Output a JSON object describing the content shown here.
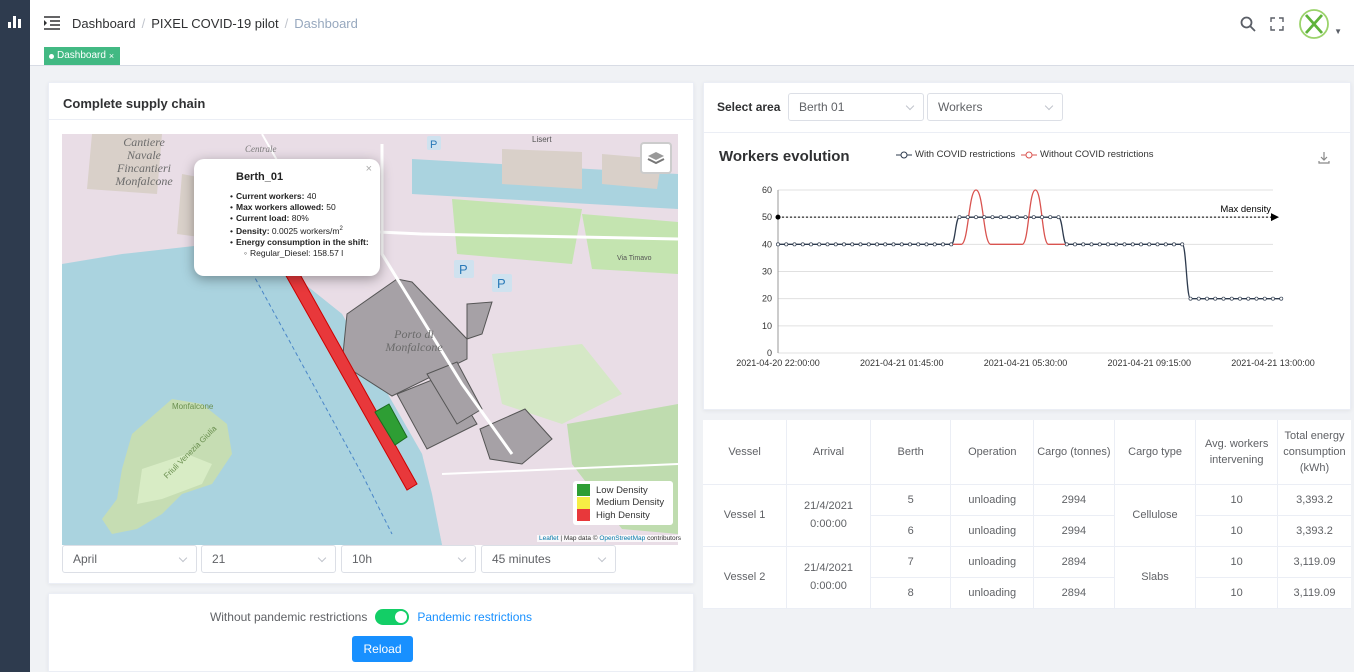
{
  "breadcrumb": [
    "Dashboard",
    "PIXEL COVID-19 pilot",
    "Dashboard"
  ],
  "tags": {
    "active": "Dashboard"
  },
  "supply_chain": {
    "title": "Complete supply chain",
    "popup": {
      "title": "Berth_01",
      "current_workers_label": "Current workers:",
      "current_workers": "40",
      "max_workers_label": "Max workers allowed:",
      "max_workers": "50",
      "current_load_label": "Current load:",
      "current_load": "80%",
      "density_label": "Density:",
      "density": "0.0025 workers/m",
      "density_exp": "2",
      "energy_label": "Energy consumption in the shift:",
      "energy_sub": "Regular_Diesel: 158.57 l"
    },
    "map_labels": {
      "cantiere": [
        "Cantiere",
        "Navale",
        "Fincantieri",
        "Monfalcone"
      ],
      "porto": [
        "Porto di",
        "Monfalcone"
      ],
      "centrale": "Centrale",
      "lisert": "Lisert",
      "via_timavo": "Via Timavo",
      "monfalcone_park": "Monfalcone",
      "friuli": "Friuli Venezia Giulia",
      "parking": "P"
    },
    "legend": [
      "Low Density",
      "Medium Density",
      "High Density"
    ],
    "legend_colors": [
      "#2e9e34",
      "#f6ee45",
      "#e8383b"
    ],
    "attribution": {
      "leaflet": "Leaflet",
      "map_data": "| Map data ©",
      "osm": "OpenStreetMap",
      "contributors": "contributors"
    },
    "filters": {
      "month": "April",
      "day": "21",
      "hour": "10h",
      "minutes": "45 minutes"
    }
  },
  "controls": {
    "left_label": "Without pandemic restrictions",
    "right_label": "Pandemic restrictions",
    "reload": "Reload"
  },
  "area_selector": {
    "label": "Select area",
    "area": "Berth 01",
    "metric": "Workers"
  },
  "chart": {
    "title": "Workers evolution",
    "series_labels": [
      "With COVID restrictions",
      "Without COVID restrictions"
    ]
  },
  "chart_data": {
    "type": "line",
    "title": "Workers evolution",
    "x_tick_labels": [
      "2021-04-20 22:00:00",
      "2021-04-21 01:45:00",
      "2021-04-21 05:30:00",
      "2021-04-21 09:15:00",
      "2021-04-21 13:00:00"
    ],
    "x_range_hours": [
      0,
      15
    ],
    "ylim": [
      0,
      60
    ],
    "yticks": [
      0,
      10,
      20,
      30,
      40,
      50,
      60
    ],
    "annotation": "Max density",
    "max_density": 50,
    "series": [
      {
        "name": "With COVID restrictions",
        "color": "#2e3b4e",
        "points": [
          [
            0,
            40
          ],
          [
            5.25,
            40
          ],
          [
            5.5,
            50
          ],
          [
            8.5,
            50
          ],
          [
            8.75,
            40
          ],
          [
            12.25,
            40
          ],
          [
            12.5,
            20
          ],
          [
            15.25,
            20
          ]
        ]
      },
      {
        "name": "Without COVID restrictions",
        "color": "#d9534f",
        "points": [
          [
            5.25,
            40
          ],
          [
            5.55,
            40
          ],
          [
            6.0,
            60
          ],
          [
            6.45,
            40
          ],
          [
            7.4,
            40
          ],
          [
            7.8,
            60
          ],
          [
            8.2,
            40
          ],
          [
            8.75,
            40
          ]
        ]
      }
    ]
  },
  "table": {
    "headers": [
      "Vessel",
      "Arrival",
      "Berth",
      "Operation",
      "Cargo (tonnes)",
      "Cargo type",
      "Avg. workers intervening",
      "Total energy consumption (kWh)"
    ],
    "groups": [
      {
        "vessel": "Vessel 1",
        "arrival": "21/4/2021 0:00:00",
        "cargo_type": "Cellulose",
        "rows": [
          {
            "berth": "5",
            "operation": "unloading",
            "cargo": "2994",
            "workers": "10",
            "energy": "3,393.2"
          },
          {
            "berth": "6",
            "operation": "unloading",
            "cargo": "2994",
            "workers": "10",
            "energy": "3,393.2"
          }
        ]
      },
      {
        "vessel": "Vessel 2",
        "arrival": "21/4/2021 0:00:00",
        "cargo_type": "Slabs",
        "rows": [
          {
            "berth": "7",
            "operation": "unloading",
            "cargo": "2894",
            "workers": "10",
            "energy": "3,119.09"
          },
          {
            "berth": "8",
            "operation": "unloading",
            "cargo": "2894",
            "workers": "10",
            "energy": "3,119.09"
          }
        ]
      }
    ]
  }
}
